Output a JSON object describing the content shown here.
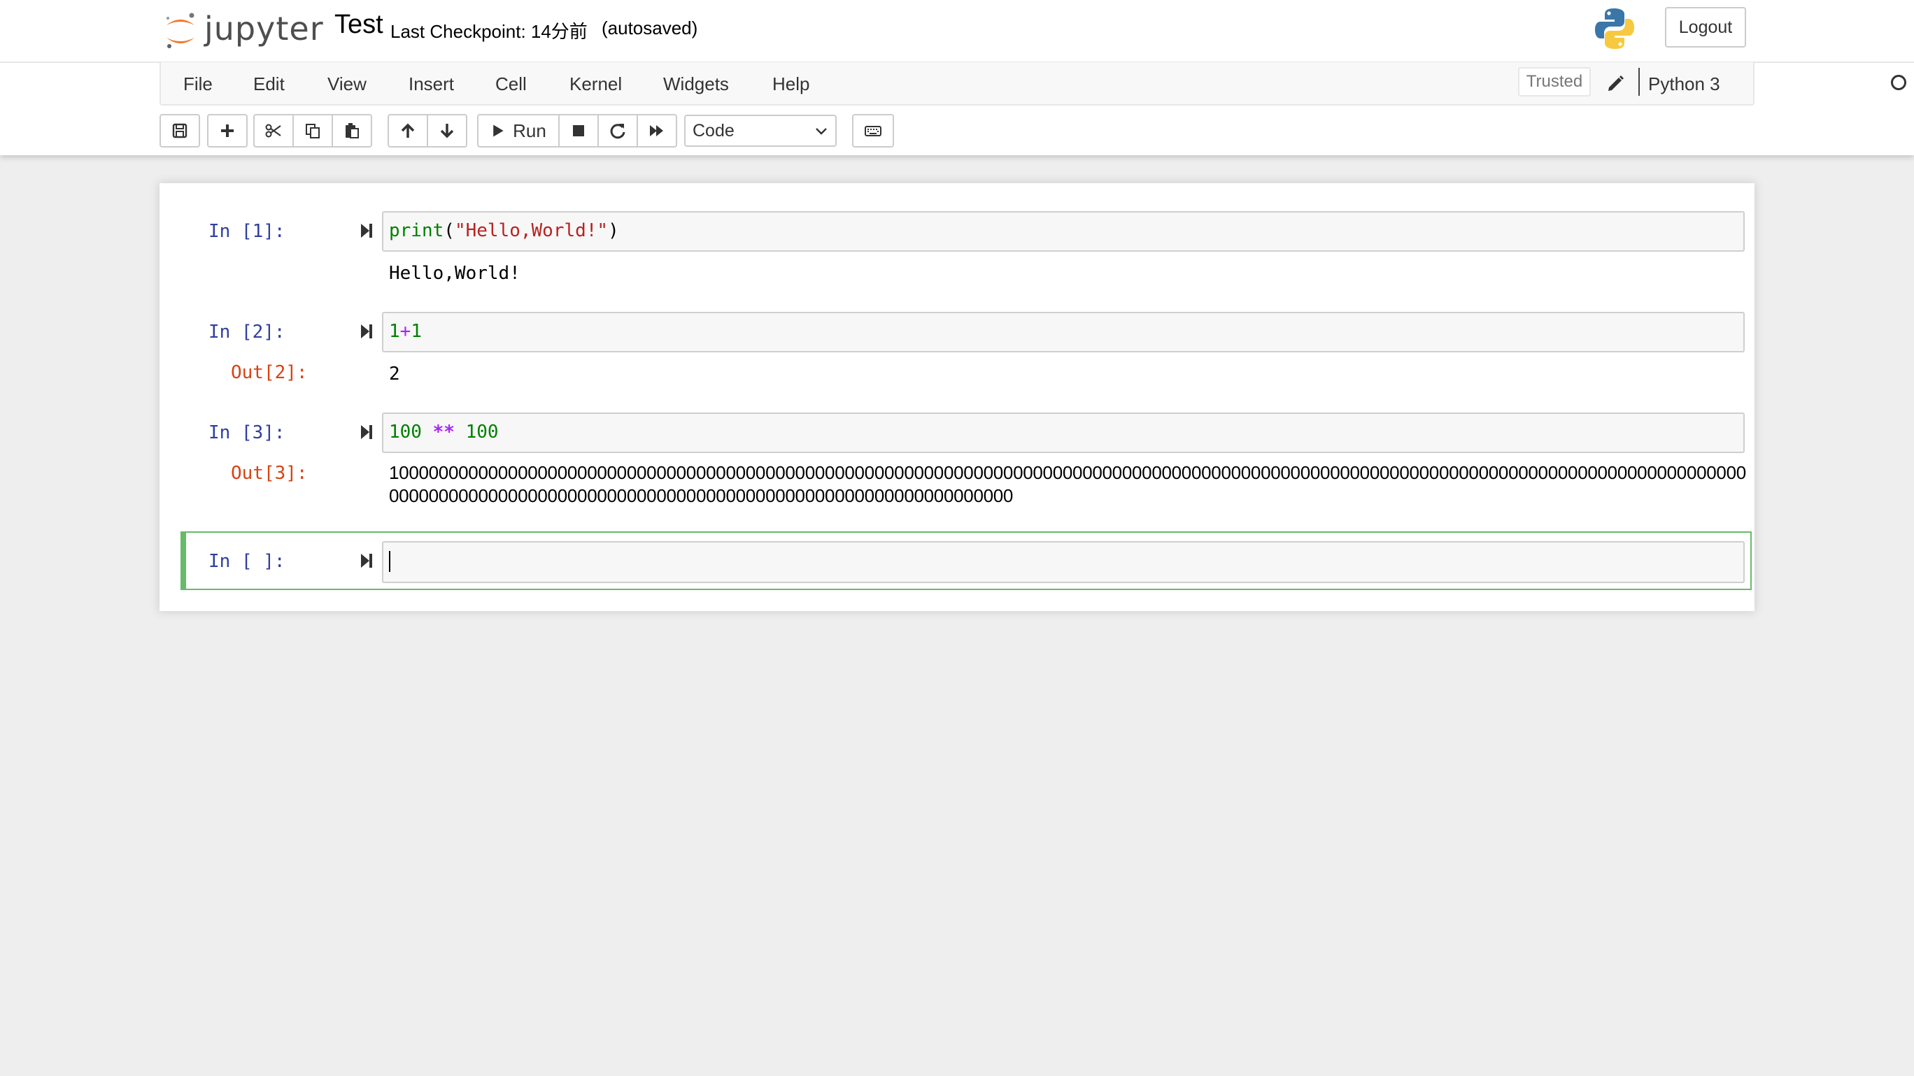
{
  "header": {
    "logo_text": "jupyter",
    "notebook_title": "Test",
    "checkpoint_text": "Last Checkpoint: 14分前",
    "autosave_text": "(autosaved)",
    "logout_label": "Logout"
  },
  "menubar": {
    "items": [
      "File",
      "Edit",
      "View",
      "Insert",
      "Cell",
      "Kernel",
      "Widgets",
      "Help"
    ],
    "trusted_label": "Trusted",
    "kernel_name": "Python 3"
  },
  "toolbar": {
    "run_label": "Run",
    "cell_type": "Code"
  },
  "cells": [
    {
      "in_prompt": "In [1]:",
      "code": {
        "func": "print",
        "open": "(",
        "string": "\"Hello,World!\"",
        "close": ")"
      },
      "output_text": "Hello,World!"
    },
    {
      "in_prompt": "In [2]:",
      "code": {
        "left": "1",
        "op": "+",
        "right": "1"
      },
      "out_prompt": "Out[2]:",
      "output_text": "2"
    },
    {
      "in_prompt": "In [3]:",
      "code": {
        "left": "100",
        "op": "**",
        "right": "100"
      },
      "out_prompt": "Out[3]:",
      "output_text": "10000000000000000000000000000000000000000000000000000000000000000000000000000000000000000000000000000000000000000000000000000000000000000000000000000000000000000000000000000000000000000000000000000000"
    },
    {
      "in_prompt": "In [ ]:",
      "code": ""
    }
  ],
  "colors": {
    "selected_cell_border": "#66bb6a",
    "in_prompt": "#303f9f",
    "out_prompt": "#d84315"
  }
}
